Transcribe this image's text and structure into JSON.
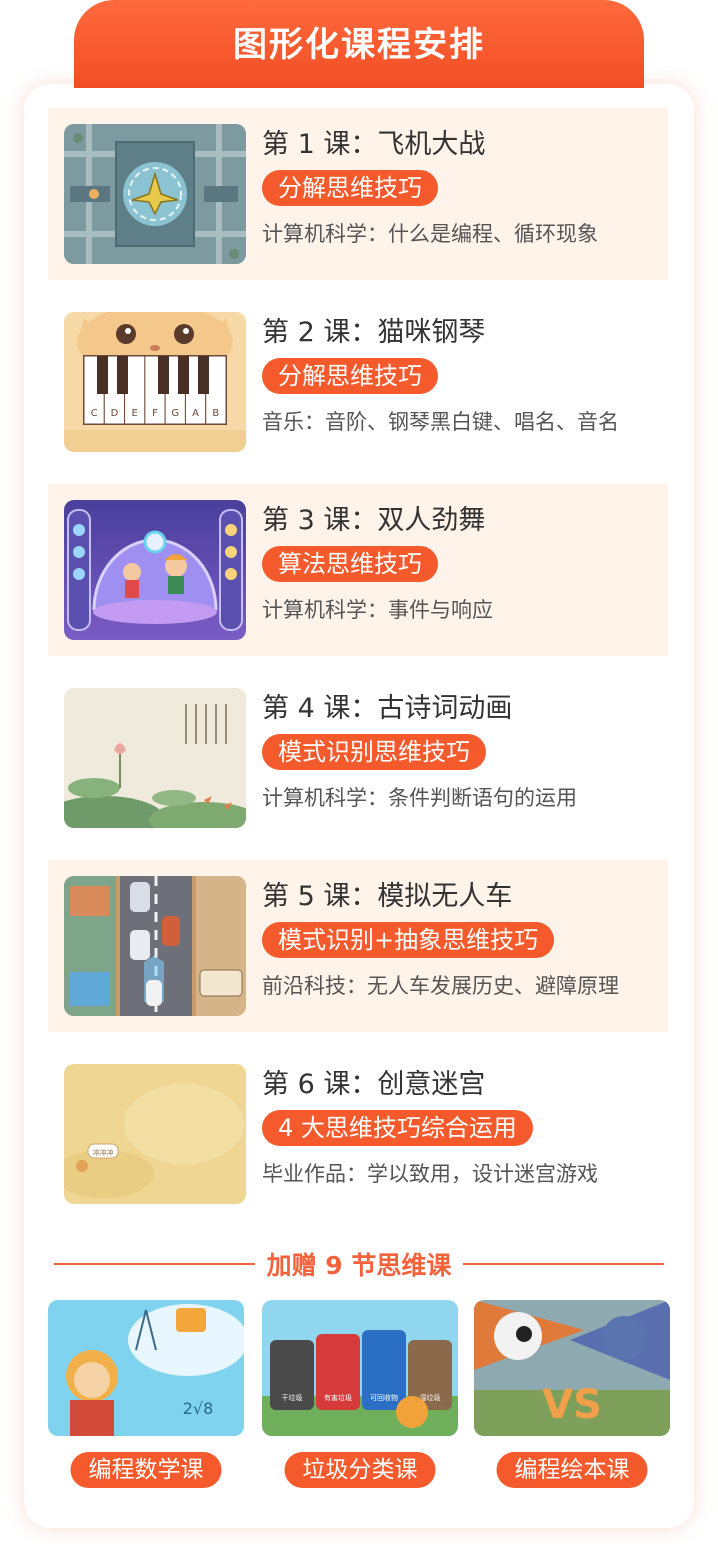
{
  "banner": {
    "title": "图形化课程安排"
  },
  "lessons": [
    {
      "title": "第 1 课：飞机大战",
      "tag": "分解思维技巧",
      "desc": "计算机科学：什么是编程、循环现象",
      "tinted": true
    },
    {
      "title": "第 2 课：猫咪钢琴",
      "tag": "分解思维技巧",
      "desc": "音乐：音阶、钢琴黑白键、唱名、音名",
      "tinted": false
    },
    {
      "title": "第 3 课：双人劲舞",
      "tag": "算法思维技巧",
      "desc": "计算机科学：事件与响应",
      "tinted": true
    },
    {
      "title": "第 4 课：古诗词动画",
      "tag": "模式识别思维技巧",
      "desc": "计算机科学：条件判断语句的运用",
      "tinted": false
    },
    {
      "title": "第 5 课：模拟无人车",
      "tag": "模式识别+抽象思维技巧",
      "desc": "前沿科技：无人车发展历史、避障原理",
      "tinted": true
    },
    {
      "title": "第 6 课：创意迷宫",
      "tag": "4 大思维技巧综合运用",
      "desc": "毕业作品：学以致用，设计迷宫游戏",
      "tinted": false
    }
  ],
  "piano_keys": [
    "C",
    "D",
    "E",
    "F",
    "G",
    "A",
    "B"
  ],
  "bonus": {
    "title": "加赠 9 节思维课",
    "courses": [
      {
        "label": "编程数学课"
      },
      {
        "label": "垃圾分类课"
      },
      {
        "label": "编程绘本课"
      }
    ]
  },
  "thumb_texts": {
    "maze_bubble": "冲冲冲",
    "math_number": "2√8",
    "bin_label_1": "干垃圾",
    "bin_label_2": "有害垃圾",
    "bin_label_3": "可回收物",
    "bin_label_4": "湿垃圾",
    "vs": "VS"
  },
  "colors": {
    "accent": "#f55a2c",
    "tint": "#fff3ea",
    "line": "#f3623a"
  }
}
